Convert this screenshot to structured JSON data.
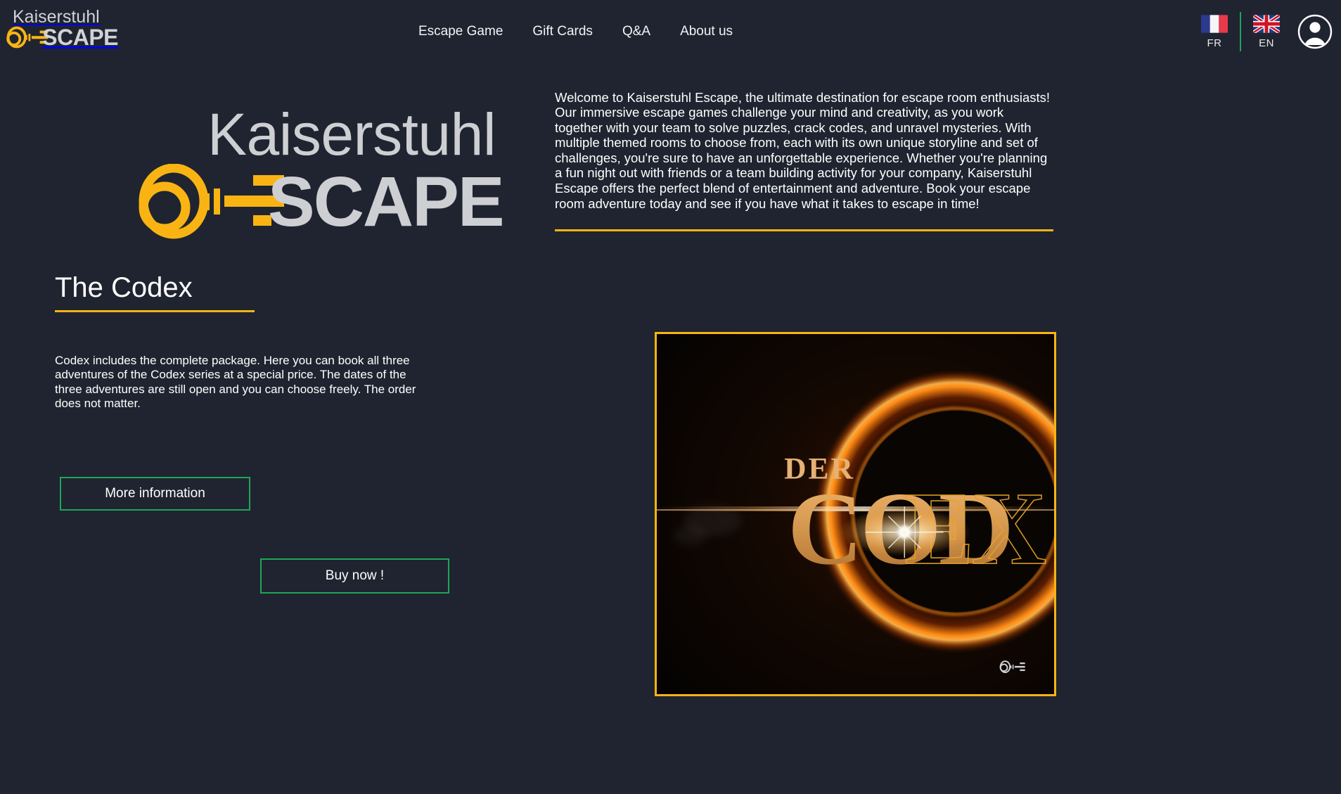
{
  "site": {
    "brand_line1": "Kaiserstuhl",
    "brand_line2": "SCAPE",
    "accent_gold": "#f9b414",
    "accent_green": "#1ea556",
    "background": "#1f2430"
  },
  "header": {
    "nav": [
      {
        "label": "Escape Game"
      },
      {
        "label": "Gift Cards"
      },
      {
        "label": "Q&A"
      },
      {
        "label": "About us"
      }
    ],
    "languages": [
      {
        "code": "FR",
        "flag": "flag-france"
      },
      {
        "code": "EN",
        "flag": "flag-united-kingdom"
      }
    ],
    "account_icon": "user-avatar-icon"
  },
  "hero": {
    "logo_line1": "Kaiserstuhl",
    "logo_line2": "SCAPE",
    "key_icon": "key-icon"
  },
  "left": {
    "title": "The Codex",
    "description": "Codex includes the complete package. Here you can book all three adventures of the Codex series at a special price. The dates of the three adventures are still open and you can choose freely. The order does not matter.",
    "more_info_label": "More information",
    "buy_label": "Buy now !"
  },
  "right": {
    "welcome": "Welcome to Kaiserstuhl Escape, the ultimate destination for escape room enthusiasts! Our immersive escape games challenge your mind and creativity, as you work together with your team to solve puzzles, crack codes, and unravel mysteries. With multiple themed rooms to choose from, each with its own unique storyline and set of challenges, you're sure to have an unforgettable experience. Whether you're planning a fun night out with friends or a team building activity for your company, Kaiserstuhl Escape offers the perfect blend of entertainment and adventure. Book your escape room adventure today and see if you have what it takes to escape in time!",
    "media": {
      "alt": "Der Codex promotional artwork",
      "overline": "DER",
      "title": "CODEX",
      "watermark": "key-escape-logo-icon"
    }
  }
}
